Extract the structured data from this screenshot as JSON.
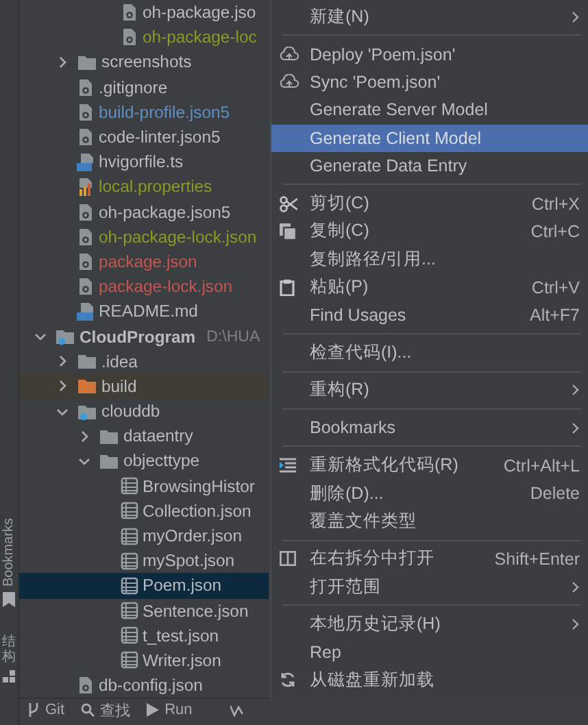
{
  "tree": {
    "hidden_folder_tail": [
      {
        "name": "oh-package.jso",
        "kind": "file",
        "selected": false
      },
      {
        "name": "oh-package-loc",
        "kind": "file",
        "color": "#8a9a22",
        "selected": false
      }
    ],
    "root_files": [
      {
        "name": "screenshots",
        "kind": "folder",
        "expanded": false,
        "selected": false
      },
      {
        "name": ".gitignore",
        "kind": "file",
        "selected": false
      },
      {
        "name": "build-profile.json5",
        "kind": "file",
        "color": "#5f8fc4",
        "selected": false
      },
      {
        "name": "code-linter.json5",
        "kind": "file",
        "selected": false
      },
      {
        "name": "hvigorfile.ts",
        "kind": "ts",
        "selected": false
      },
      {
        "name": "local.properties",
        "kind": "properties",
        "color": "#8a9a22",
        "selected": false
      },
      {
        "name": "oh-package.json5",
        "kind": "file",
        "selected": false
      },
      {
        "name": "oh-package-lock.json",
        "kind": "file",
        "color": "#8a9a22",
        "selected": false
      },
      {
        "name": "package.json",
        "kind": "file",
        "color": "#c75450",
        "selected": false
      },
      {
        "name": "package-lock.json",
        "kind": "file",
        "color": "#c75450",
        "selected": false
      },
      {
        "name": "README.md",
        "kind": "md",
        "selected": false
      }
    ],
    "project": {
      "name": "CloudProgram",
      "path": "D:\\HUA",
      "kind": "project",
      "expanded": true,
      "selected": false,
      "children": [
        {
          "name": ".idea",
          "kind": "folder",
          "expanded": false,
          "selected": false
        },
        {
          "name": "build",
          "kind": "excluded",
          "expanded": false,
          "selected": false
        },
        {
          "name": "clouddb",
          "kind": "module",
          "expanded": true,
          "selected": false,
          "children": [
            {
              "name": "dataentry",
              "kind": "folder",
              "expanded": false,
              "selected": false
            },
            {
              "name": "objecttype",
              "kind": "folder",
              "expanded": true,
              "selected": false,
              "children": [
                {
                  "name": "BrowsingHistor",
                  "kind": "schema",
                  "selected": false
                },
                {
                  "name": "Collection.json",
                  "kind": "schema",
                  "selected": false
                },
                {
                  "name": "myOrder.json",
                  "kind": "schema",
                  "selected": false
                },
                {
                  "name": "mySpot.json",
                  "kind": "schema",
                  "selected": false
                },
                {
                  "name": "Poem.json",
                  "kind": "schema",
                  "selected": true
                },
                {
                  "name": "Sentence.json",
                  "kind": "schema",
                  "selected": false
                },
                {
                  "name": "t_test.json",
                  "kind": "schema",
                  "selected": false
                },
                {
                  "name": "Writer.json",
                  "kind": "schema",
                  "selected": false
                }
              ]
            }
          ]
        },
        {
          "name": "db-config.json",
          "kind": "file",
          "selected": false
        }
      ]
    }
  },
  "side_strip": {
    "bookmarks_label": "Bookmarks",
    "structure_label": "结构"
  },
  "bottom_tools": [
    {
      "label": "Git",
      "kind": "git"
    },
    {
      "label": "查找",
      "kind": "find"
    },
    {
      "label": "Run",
      "kind": "run"
    }
  ],
  "context_menu": [
    {
      "kind": "plain",
      "label": "新建(N)",
      "submenu": true,
      "selected": false
    },
    {
      "kind": "separator"
    },
    {
      "kind": "cloud",
      "label": "Deploy 'Poem.json'",
      "submenu": false,
      "selected": false
    },
    {
      "kind": "cloud",
      "label": "Sync 'Poem.json'",
      "submenu": false,
      "selected": false
    },
    {
      "kind": "plain",
      "label": "Generate Server Model",
      "submenu": false,
      "selected": false
    },
    {
      "kind": "plain",
      "label": "Generate Client Model",
      "submenu": false,
      "selected": true
    },
    {
      "kind": "plain",
      "label": "Generate Data Entry",
      "submenu": false,
      "selected": false
    },
    {
      "kind": "separator"
    },
    {
      "kind": "cut",
      "label": "剪切(C)",
      "shortcut": "Ctrl+X",
      "submenu": false,
      "selected": false
    },
    {
      "kind": "copy",
      "label": "复制(C)",
      "shortcut": "Ctrl+C",
      "submenu": false,
      "selected": false
    },
    {
      "kind": "plain",
      "label": "复制路径/引用...",
      "submenu": false,
      "selected": false
    },
    {
      "kind": "paste",
      "label": "粘贴(P)",
      "shortcut": "Ctrl+V",
      "submenu": false,
      "selected": false
    },
    {
      "kind": "plain",
      "label": "Find Usages",
      "shortcut": "Alt+F7",
      "submenu": false,
      "selected": false
    },
    {
      "kind": "separator"
    },
    {
      "kind": "plain",
      "label": "检查代码(I)...",
      "submenu": false,
      "selected": false
    },
    {
      "kind": "separator"
    },
    {
      "kind": "plain",
      "label": "重构(R)",
      "submenu": true,
      "selected": false
    },
    {
      "kind": "separator"
    },
    {
      "kind": "plain",
      "label": "Bookmarks",
      "submenu": true,
      "selected": false
    },
    {
      "kind": "separator"
    },
    {
      "kind": "format",
      "label": "重新格式化代码(R)",
      "shortcut": "Ctrl+Alt+L",
      "submenu": false,
      "selected": false
    },
    {
      "kind": "plain",
      "label": "删除(D)...",
      "shortcut": "Delete",
      "submenu": false,
      "selected": false
    },
    {
      "kind": "plain",
      "label": "覆盖文件类型",
      "submenu": false,
      "selected": false
    },
    {
      "kind": "separator"
    },
    {
      "kind": "split",
      "label": "在右拆分中打开",
      "shortcut": "Shift+Enter",
      "submenu": false,
      "selected": false
    },
    {
      "kind": "plain",
      "label": "打开范围",
      "submenu": true,
      "selected": false
    },
    {
      "kind": "separator"
    },
    {
      "kind": "plain",
      "label": "本地历史记录(H)",
      "submenu": true,
      "selected": false
    },
    {
      "kind": "plain",
      "label": "Rep",
      "submenu": false,
      "selected": false
    },
    {
      "kind": "reload",
      "label": "从磁盘重新加载",
      "submenu": false,
      "selected": false
    }
  ]
}
